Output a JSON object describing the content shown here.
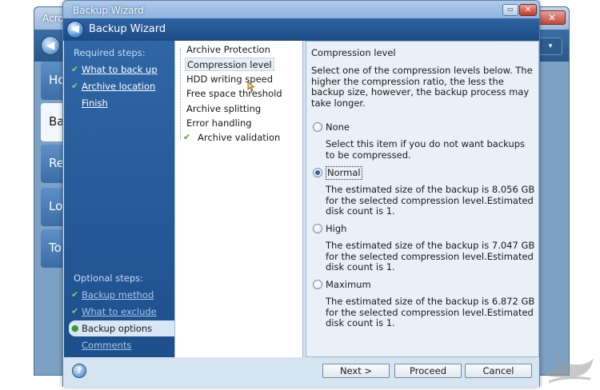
{
  "background_window": {
    "title": "Acro",
    "close_glyph": "✕",
    "back_glyph": "◀",
    "dropdown_glyph": "▾",
    "sidebar_items": [
      {
        "label": "Ho"
      },
      {
        "label": "Ba",
        "active": true
      },
      {
        "label": "Re"
      },
      {
        "label": "Lo"
      },
      {
        "label": "To"
      }
    ]
  },
  "wizard": {
    "window_title": "Backup Wizard",
    "heading": "Backup Wizard",
    "titlebar_buttons": {
      "restore_glyph": "▭",
      "close_glyph": "✕"
    },
    "back_glyph": "◀",
    "required_label": "Required steps:",
    "required_steps": [
      {
        "label": "What to back up",
        "done": true
      },
      {
        "label": "Archive location",
        "done": true
      },
      {
        "label": "Finish",
        "done": false
      }
    ],
    "optional_label": "Optional steps:",
    "optional_steps": [
      {
        "label": "Backup method",
        "done": true
      },
      {
        "label": "What to exclude",
        "done": true
      },
      {
        "label": "Backup options",
        "current": true
      },
      {
        "label": "Comments",
        "done": false
      }
    ],
    "options_list": [
      {
        "label": "Archive Protection"
      },
      {
        "label": "Compression level",
        "selected": true
      },
      {
        "label": "HDD writing speed"
      },
      {
        "label": "Free space threshold"
      },
      {
        "label": "Archive splitting"
      },
      {
        "label": "Error handling"
      },
      {
        "label": "Archive validation",
        "checked": true
      }
    ],
    "detail": {
      "heading": "Compression level",
      "intro": "Select one of the compression levels below. The higher the compression ratio, the less the backup size, however, the backup process may take longer.",
      "levels": [
        {
          "label": "None",
          "selected": false,
          "description": "Select this item if you do not want backups to be compressed."
        },
        {
          "label": "Normal",
          "selected": true,
          "description": "The estimated size of the backup is 8.056 GB for the selected compression level.Estimated disk count is 1."
        },
        {
          "label": "High",
          "selected": false,
          "description": "The estimated size of the backup is 7.047 GB for the selected compression level.Estimated disk count is 1."
        },
        {
          "label": "Maximum",
          "selected": false,
          "description": "The estimated size of the backup is 6.872 GB for the selected compression level.Estimated disk count is 1."
        }
      ]
    },
    "buttons": {
      "help": "?",
      "next": "Next >",
      "proceed": "Proceed",
      "cancel": "Cancel"
    }
  },
  "colors": {
    "header_blue": "#1d4b84",
    "step_pane_blue": "#2f66a5",
    "check_green": "#44a52f",
    "detail_background": "#e9f0f8"
  },
  "icons": [
    "back-arrow-icon",
    "check-icon",
    "gear-icon",
    "help-icon",
    "close-icon",
    "restore-icon",
    "mouse-cursor-icon"
  ]
}
